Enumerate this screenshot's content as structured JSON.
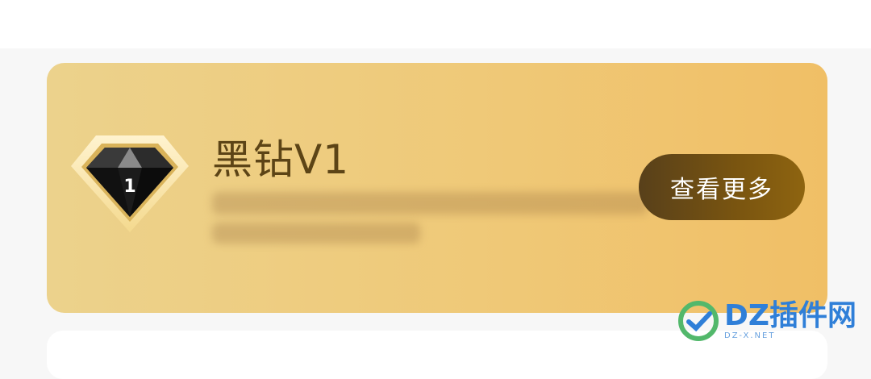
{
  "member_card": {
    "title": "黑钻V1",
    "level_number": "1",
    "more_button_label": "查看更多"
  },
  "watermark": {
    "main": "DZ插件网",
    "sub": "DZ-X.NET"
  },
  "colors": {
    "card_gradient_start": "#ecd28c",
    "card_gradient_end": "#f0bf66",
    "button_dark": "#58401a",
    "title_brown": "#5c4416"
  }
}
